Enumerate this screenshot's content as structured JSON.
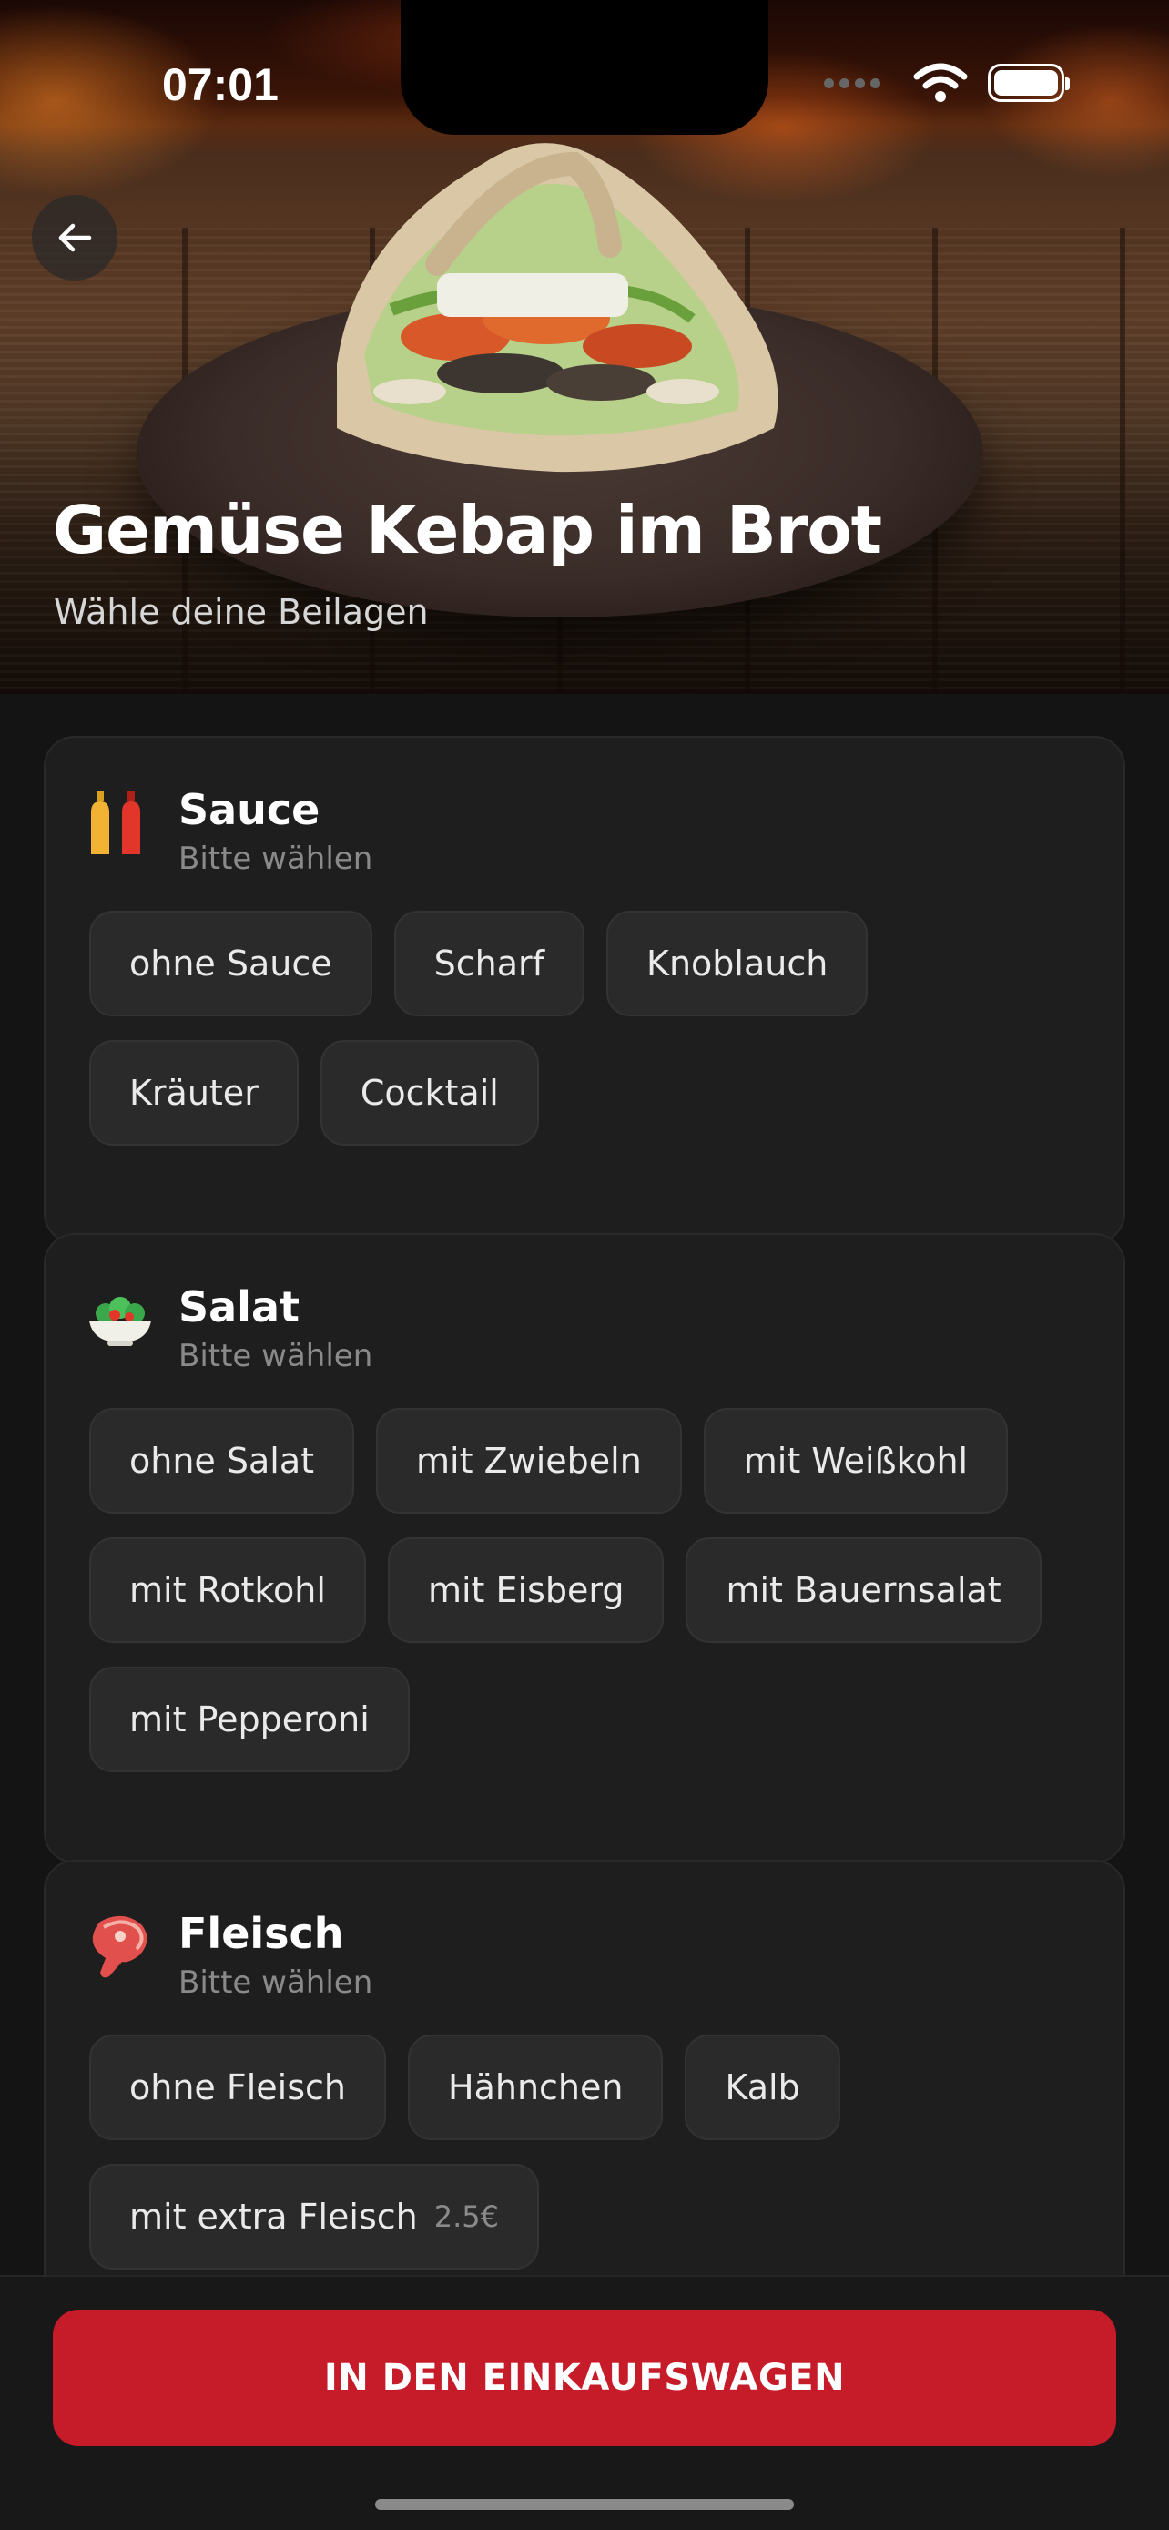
{
  "status_bar": {
    "time": "07:01"
  },
  "hero": {
    "title": "Gemüse Kebap im Brot",
    "subtitle": "Wähle deine Beilagen"
  },
  "sections": [
    {
      "title": "Sauce",
      "subtitle": "Bitte wählen",
      "icon": "sauce-bottles-icon",
      "options": [
        "ohne Sauce",
        "Scharf",
        "Knoblauch",
        "Kräuter",
        "Cocktail"
      ]
    },
    {
      "title": "Salat",
      "subtitle": "Bitte wählen",
      "icon": "salad-bowl-icon",
      "options": [
        "ohne Salat",
        "mit Zwiebeln",
        "mit Weißkohl",
        "mit Rotkohl",
        "mit Eisberg",
        "mit Bauernsalat",
        "mit Pepperoni"
      ]
    },
    {
      "title": "Fleisch",
      "subtitle": "Bitte wählen",
      "icon": "meat-icon",
      "options": [
        "ohne Fleisch",
        "Hähnchen",
        "Kalb",
        "mit extra Fleisch"
      ],
      "extra_price": "2.5€"
    }
  ],
  "cart_button": {
    "label": "IN DEN EINKAUFSWAGEN"
  },
  "colors": {
    "accent": "#c61b28",
    "background": "#141414",
    "card": "#1e1e1e",
    "chip": "#2a2a2a"
  }
}
